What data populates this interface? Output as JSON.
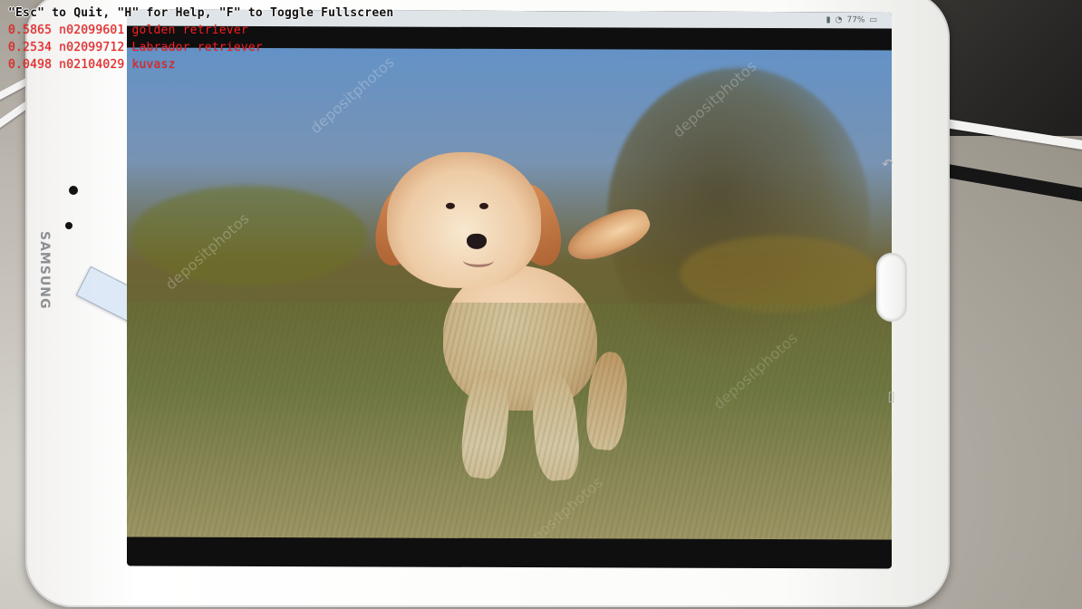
{
  "overlay": {
    "help_text": "\"Esc\" to Quit, \"H\" for Help, \"F\" to Toggle Fullscreen",
    "predictions": [
      {
        "text": "0.5865 n02099601 golden retriever"
      },
      {
        "text": "0.2534 n02099712 Labrador retriever"
      },
      {
        "text": "0.0498 n02104029 kuvasz"
      }
    ],
    "colors": {
      "help": "#111111",
      "prediction": "#ff1f1f"
    }
  },
  "device": {
    "brand": "SAMSUNG"
  },
  "screen": {
    "status_text": "77%",
    "watermarks": [
      "depositphotos",
      "depositphotos",
      "depositphotos",
      "depositphotos",
      "depositphotos"
    ]
  },
  "icons": {
    "back": "back-icon",
    "recent": "recent-apps-icon"
  }
}
